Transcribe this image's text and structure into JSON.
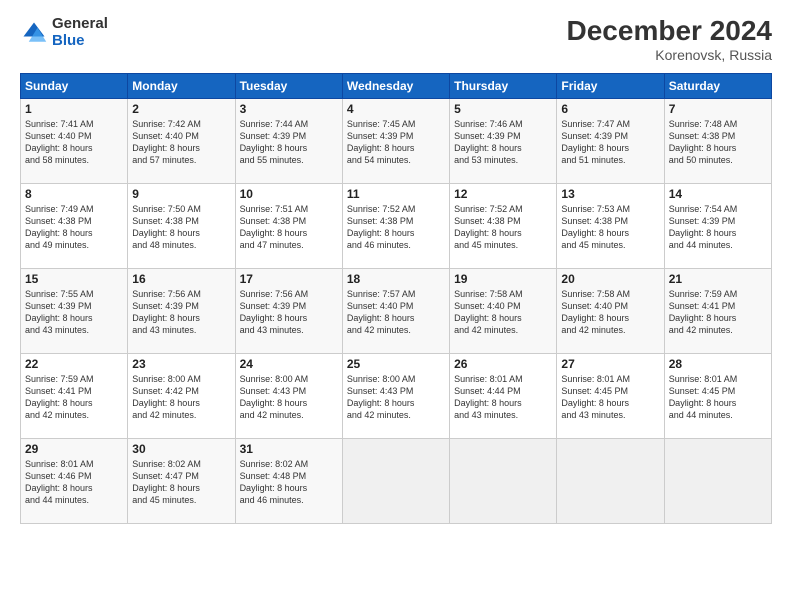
{
  "header": {
    "logo_general": "General",
    "logo_blue": "Blue",
    "month_title": "December 2024",
    "location": "Korenovsk, Russia"
  },
  "weekdays": [
    "Sunday",
    "Monday",
    "Tuesday",
    "Wednesday",
    "Thursday",
    "Friday",
    "Saturday"
  ],
  "weeks": [
    [
      {
        "day": "1",
        "lines": [
          "Sunrise: 7:41 AM",
          "Sunset: 4:40 PM",
          "Daylight: 8 hours",
          "and 58 minutes."
        ]
      },
      {
        "day": "2",
        "lines": [
          "Sunrise: 7:42 AM",
          "Sunset: 4:40 PM",
          "Daylight: 8 hours",
          "and 57 minutes."
        ]
      },
      {
        "day": "3",
        "lines": [
          "Sunrise: 7:44 AM",
          "Sunset: 4:39 PM",
          "Daylight: 8 hours",
          "and 55 minutes."
        ]
      },
      {
        "day": "4",
        "lines": [
          "Sunrise: 7:45 AM",
          "Sunset: 4:39 PM",
          "Daylight: 8 hours",
          "and 54 minutes."
        ]
      },
      {
        "day": "5",
        "lines": [
          "Sunrise: 7:46 AM",
          "Sunset: 4:39 PM",
          "Daylight: 8 hours",
          "and 53 minutes."
        ]
      },
      {
        "day": "6",
        "lines": [
          "Sunrise: 7:47 AM",
          "Sunset: 4:39 PM",
          "Daylight: 8 hours",
          "and 51 minutes."
        ]
      },
      {
        "day": "7",
        "lines": [
          "Sunrise: 7:48 AM",
          "Sunset: 4:38 PM",
          "Daylight: 8 hours",
          "and 50 minutes."
        ]
      }
    ],
    [
      {
        "day": "8",
        "lines": [
          "Sunrise: 7:49 AM",
          "Sunset: 4:38 PM",
          "Daylight: 8 hours",
          "and 49 minutes."
        ]
      },
      {
        "day": "9",
        "lines": [
          "Sunrise: 7:50 AM",
          "Sunset: 4:38 PM",
          "Daylight: 8 hours",
          "and 48 minutes."
        ]
      },
      {
        "day": "10",
        "lines": [
          "Sunrise: 7:51 AM",
          "Sunset: 4:38 PM",
          "Daylight: 8 hours",
          "and 47 minutes."
        ]
      },
      {
        "day": "11",
        "lines": [
          "Sunrise: 7:52 AM",
          "Sunset: 4:38 PM",
          "Daylight: 8 hours",
          "and 46 minutes."
        ]
      },
      {
        "day": "12",
        "lines": [
          "Sunrise: 7:52 AM",
          "Sunset: 4:38 PM",
          "Daylight: 8 hours",
          "and 45 minutes."
        ]
      },
      {
        "day": "13",
        "lines": [
          "Sunrise: 7:53 AM",
          "Sunset: 4:38 PM",
          "Daylight: 8 hours",
          "and 45 minutes."
        ]
      },
      {
        "day": "14",
        "lines": [
          "Sunrise: 7:54 AM",
          "Sunset: 4:39 PM",
          "Daylight: 8 hours",
          "and 44 minutes."
        ]
      }
    ],
    [
      {
        "day": "15",
        "lines": [
          "Sunrise: 7:55 AM",
          "Sunset: 4:39 PM",
          "Daylight: 8 hours",
          "and 43 minutes."
        ]
      },
      {
        "day": "16",
        "lines": [
          "Sunrise: 7:56 AM",
          "Sunset: 4:39 PM",
          "Daylight: 8 hours",
          "and 43 minutes."
        ]
      },
      {
        "day": "17",
        "lines": [
          "Sunrise: 7:56 AM",
          "Sunset: 4:39 PM",
          "Daylight: 8 hours",
          "and 43 minutes."
        ]
      },
      {
        "day": "18",
        "lines": [
          "Sunrise: 7:57 AM",
          "Sunset: 4:40 PM",
          "Daylight: 8 hours",
          "and 42 minutes."
        ]
      },
      {
        "day": "19",
        "lines": [
          "Sunrise: 7:58 AM",
          "Sunset: 4:40 PM",
          "Daylight: 8 hours",
          "and 42 minutes."
        ]
      },
      {
        "day": "20",
        "lines": [
          "Sunrise: 7:58 AM",
          "Sunset: 4:40 PM",
          "Daylight: 8 hours",
          "and 42 minutes."
        ]
      },
      {
        "day": "21",
        "lines": [
          "Sunrise: 7:59 AM",
          "Sunset: 4:41 PM",
          "Daylight: 8 hours",
          "and 42 minutes."
        ]
      }
    ],
    [
      {
        "day": "22",
        "lines": [
          "Sunrise: 7:59 AM",
          "Sunset: 4:41 PM",
          "Daylight: 8 hours",
          "and 42 minutes."
        ]
      },
      {
        "day": "23",
        "lines": [
          "Sunrise: 8:00 AM",
          "Sunset: 4:42 PM",
          "Daylight: 8 hours",
          "and 42 minutes."
        ]
      },
      {
        "day": "24",
        "lines": [
          "Sunrise: 8:00 AM",
          "Sunset: 4:43 PM",
          "Daylight: 8 hours",
          "and 42 minutes."
        ]
      },
      {
        "day": "25",
        "lines": [
          "Sunrise: 8:00 AM",
          "Sunset: 4:43 PM",
          "Daylight: 8 hours",
          "and 42 minutes."
        ]
      },
      {
        "day": "26",
        "lines": [
          "Sunrise: 8:01 AM",
          "Sunset: 4:44 PM",
          "Daylight: 8 hours",
          "and 43 minutes."
        ]
      },
      {
        "day": "27",
        "lines": [
          "Sunrise: 8:01 AM",
          "Sunset: 4:45 PM",
          "Daylight: 8 hours",
          "and 43 minutes."
        ]
      },
      {
        "day": "28",
        "lines": [
          "Sunrise: 8:01 AM",
          "Sunset: 4:45 PM",
          "Daylight: 8 hours",
          "and 44 minutes."
        ]
      }
    ],
    [
      {
        "day": "29",
        "lines": [
          "Sunrise: 8:01 AM",
          "Sunset: 4:46 PM",
          "Daylight: 8 hours",
          "and 44 minutes."
        ]
      },
      {
        "day": "30",
        "lines": [
          "Sunrise: 8:02 AM",
          "Sunset: 4:47 PM",
          "Daylight: 8 hours",
          "and 45 minutes."
        ]
      },
      {
        "day": "31",
        "lines": [
          "Sunrise: 8:02 AM",
          "Sunset: 4:48 PM",
          "Daylight: 8 hours",
          "and 46 minutes."
        ]
      },
      {
        "day": "",
        "lines": []
      },
      {
        "day": "",
        "lines": []
      },
      {
        "day": "",
        "lines": []
      },
      {
        "day": "",
        "lines": []
      }
    ]
  ]
}
